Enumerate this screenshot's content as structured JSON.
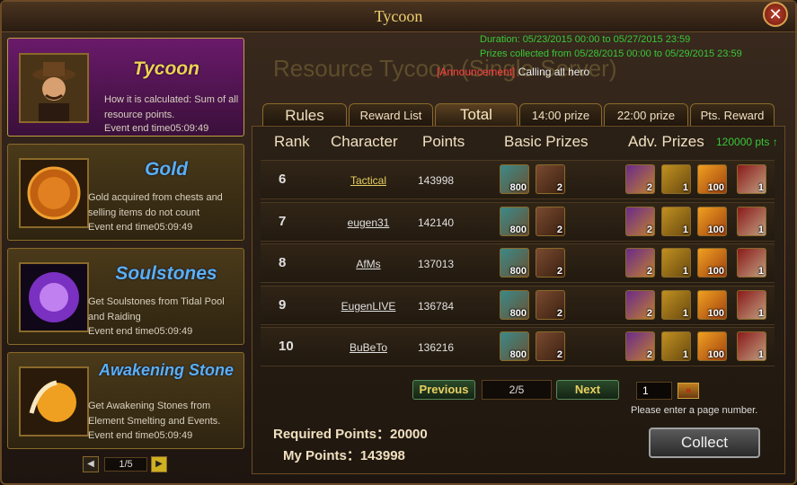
{
  "window": {
    "title": "Tycoon",
    "close": "✕"
  },
  "info": {
    "duration": "Duration: 05/23/2015 00:00 to 05/27/2015 23:59",
    "prizes_collected": "Prizes collected from 05/28/2015 00:00 to 05/29/2015 23:59"
  },
  "bg_title": "Resource Tycoon (Single Server)",
  "announcement": {
    "tag": "[Announcement]",
    "text": " Calling all hero"
  },
  "left": {
    "cards": [
      {
        "name": "Tycoon",
        "desc": "How it is calculated: Sum of all resource points.",
        "end": "Event end time05:09:49",
        "icon": "tycoon-portrait"
      },
      {
        "name": "Gold",
        "desc": "Gold acquired from chests and selling items do not count",
        "end": "Event end time05:09:49",
        "icon": "gold-coin"
      },
      {
        "name": "Soulstones",
        "desc": "Get Soulstones from Tidal Pool and Raiding",
        "end": "Event end time05:09:49",
        "icon": "soulstone-orb"
      },
      {
        "name": "Awakening Stone",
        "desc": "Get Awakening Stones from Element Smelting and Events.",
        "end": "Event end time05:09:49",
        "icon": "awakening-stone"
      }
    ],
    "pager": "1/5"
  },
  "tabs": [
    "Rules",
    "Reward List",
    "Total",
    "14:00 prize",
    "22:00 prize",
    "Pts. Reward"
  ],
  "headers": {
    "rank": "Rank",
    "character": "Character",
    "points": "Points",
    "basic": "Basic Prizes",
    "adv": "Adv. Prizes",
    "pts": "120000 pts ↑"
  },
  "rows": [
    {
      "rank": "6",
      "character": "Tactical",
      "points": "143998"
    },
    {
      "rank": "7",
      "character": "eugen31",
      "points": "142140"
    },
    {
      "rank": "8",
      "character": "AfMs",
      "points": "137013"
    },
    {
      "rank": "9",
      "character": "EugenLIVE",
      "points": "136784"
    },
    {
      "rank": "10",
      "character": "BuBeTo",
      "points": "136216"
    }
  ],
  "prizes": {
    "basic": [
      {
        "icon": "scroll",
        "qty": "800"
      },
      {
        "icon": "chest",
        "qty": "2"
      }
    ],
    "adv": [
      {
        "icon": "purple-pack",
        "qty": "2"
      },
      {
        "icon": "gold-pack",
        "qty": "1"
      },
      {
        "icon": "flame-crystal",
        "qty": "100"
      },
      {
        "icon": "red-gear",
        "qty": "1"
      }
    ]
  },
  "pager": {
    "previous": "Previous",
    "page": "2/5",
    "next": "Next",
    "input": "1",
    "go": "»",
    "hint": "Please enter a page number."
  },
  "required_points": "Required Points：20000",
  "my_points": "My Points：143998",
  "collect": "Collect"
}
